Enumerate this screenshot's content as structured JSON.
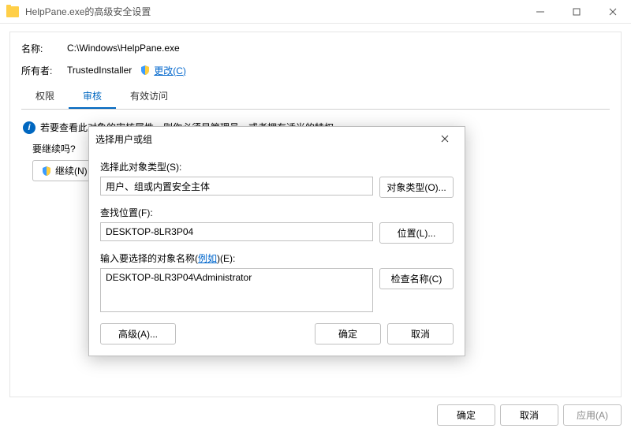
{
  "window": {
    "title": "HelpPane.exe的高级安全设置"
  },
  "fields": {
    "name_label": "名称:",
    "name_value": "C:\\Windows\\HelpPane.exe",
    "owner_label": "所有者:",
    "owner_value": "TrustedInstaller",
    "change_link": "更改(C)"
  },
  "tabs": {
    "perm": "权限",
    "audit": "审核",
    "effective": "有效访问"
  },
  "info_text": "若要查看此对象的审核属性，则你必须是管理员，或者拥有适当的特权。",
  "continue": {
    "label": "要继续吗?",
    "button": "继续(N)"
  },
  "bottom": {
    "ok": "确定",
    "cancel": "取消",
    "apply": "应用(A)"
  },
  "modal": {
    "title": "选择用户或组",
    "object_type_label": "选择此对象类型(S):",
    "object_type_value": "用户、组或内置安全主体",
    "object_type_button": "对象类型(O)...",
    "location_label": "查找位置(F):",
    "location_value": "DESKTOP-8LR3P04",
    "location_button": "位置(L)...",
    "name_label_prefix": "输入要选择的对象名称(",
    "name_label_link": "例如",
    "name_label_suffix": ")(E):",
    "name_value": "DESKTOP-8LR3P04\\Administrator",
    "check_button": "检查名称(C)",
    "advanced_button": "高级(A)...",
    "ok": "确定",
    "cancel": "取消"
  }
}
